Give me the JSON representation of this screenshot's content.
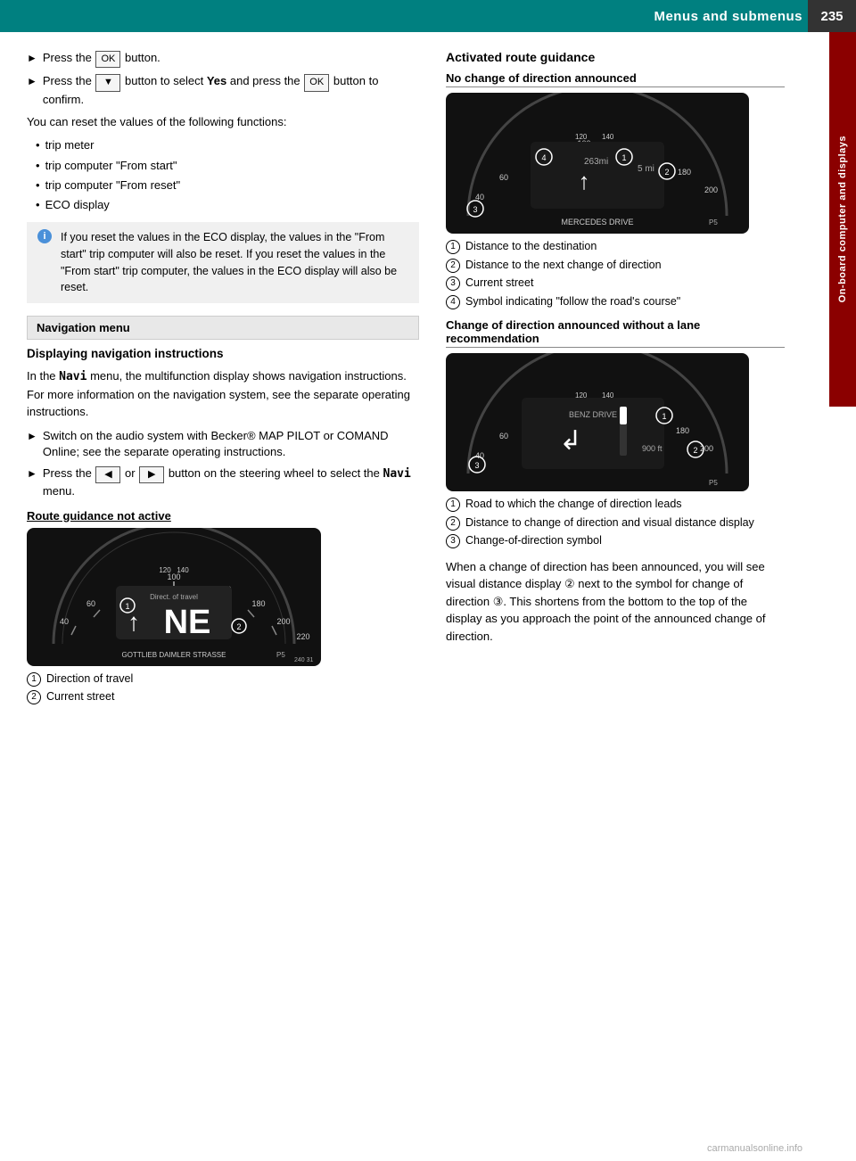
{
  "header": {
    "title": "Menus and submenus",
    "page_number": "235"
  },
  "side_tab": {
    "text": "On-board computer and displays"
  },
  "left_col": {
    "bullet1": {
      "text1": "Press the",
      "btn1": "OK",
      "text2": "button."
    },
    "bullet2": {
      "text1": "Press the",
      "btn1": "▼",
      "text2": "button to select",
      "highlight": "Yes",
      "text3": "and press the",
      "btn2": "OK",
      "text4": "button to confirm."
    },
    "reset_text": "You can reset the values of the following functions:",
    "reset_items": [
      "trip meter",
      "trip computer \"From start\"",
      "trip computer \"From reset\"",
      "ECO display"
    ],
    "info_text": "If you reset the values in the ECO display, the values in the \"From start\" trip computer will also be reset. If you reset the values in the \"From start\" trip computer, the values in the ECO display will also be reset.",
    "nav_menu_label": "Navigation menu",
    "displaying_heading": "Displaying navigation instructions",
    "navi_para": "In the Navi menu, the multifunction display shows navigation instructions. For more information on the navigation system, see the separate operating instructions.",
    "bullet3": "Switch on the audio system with Becker® MAP PILOT or COMAND Online; see the separate operating instructions.",
    "bullet4_text1": "Press the",
    "bullet4_btn1": "◄",
    "bullet4_text2": "or",
    "bullet4_btn2": "►",
    "bullet4_text3": "button on the steering wheel to select the",
    "bullet4_navi": "Navi",
    "bullet4_text4": "menu.",
    "route_not_active_heading": "Route guidance not active",
    "captions_route": [
      "Direction of travel",
      "Current street"
    ]
  },
  "right_col": {
    "activated_heading": "Activated route guidance",
    "no_change_heading": "No change of direction announced",
    "no_change_captions": [
      "Distance to the destination",
      "Distance to the next change of direction",
      "Current street",
      "Symbol indicating \"follow the road's course\""
    ],
    "change_announced_heading": "Change of direction announced without a lane recommendation",
    "change_captions": [
      "Road to which the change of direction leads",
      "Distance to change of direction and visual distance display",
      "Change-of-direction symbol"
    ],
    "closing_para": "When a change of direction has been announced, you will see visual distance display ② next to the symbol for change of direction ③. This shortens from the bottom to the top of the display as you approach the point of the announced change of direction."
  },
  "watermark": "carmanualsonline.info"
}
